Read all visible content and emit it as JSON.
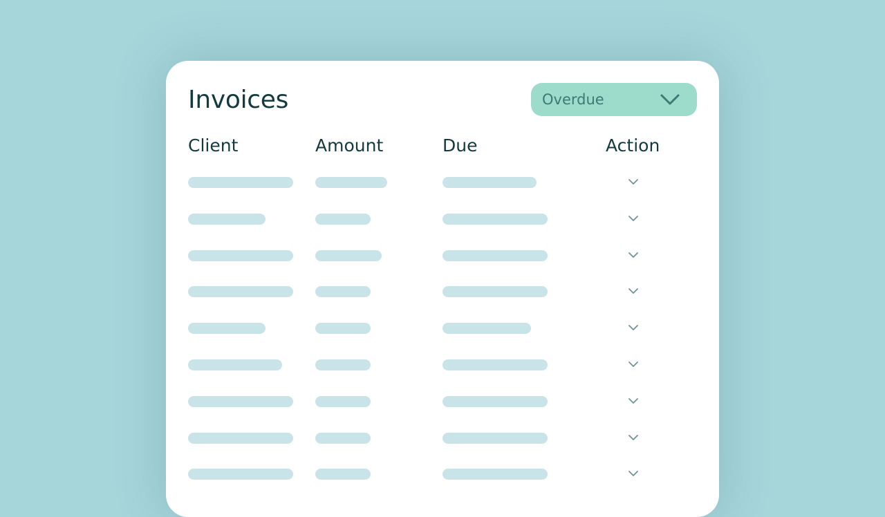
{
  "page": {
    "title": "Invoices"
  },
  "filter": {
    "selected": "Overdue",
    "icon": "chevron-down-icon"
  },
  "table": {
    "columns": [
      "Client",
      "Amount",
      "Due",
      "Action"
    ],
    "rows": [
      {
        "client": "",
        "amount": "",
        "due": "",
        "action_icon": "chevron-down-icon"
      },
      {
        "client": "",
        "amount": "",
        "due": "",
        "action_icon": "chevron-down-icon"
      },
      {
        "client": "",
        "amount": "",
        "due": "",
        "action_icon": "chevron-down-icon"
      },
      {
        "client": "",
        "amount": "",
        "due": "",
        "action_icon": "chevron-down-icon"
      },
      {
        "client": "",
        "amount": "",
        "due": "",
        "action_icon": "chevron-down-icon"
      },
      {
        "client": "",
        "amount": "",
        "due": "",
        "action_icon": "chevron-down-icon"
      },
      {
        "client": "",
        "amount": "",
        "due": "",
        "action_icon": "chevron-down-icon"
      },
      {
        "client": "",
        "amount": "",
        "due": "",
        "action_icon": "chevron-down-icon"
      },
      {
        "client": "",
        "amount": "",
        "due": "",
        "action_icon": "chevron-down-icon"
      }
    ]
  },
  "colors": {
    "background": "#a6d5da",
    "card": "#ffffff",
    "text": "#133a3f",
    "filter_bg": "#9ddbca",
    "filter_text": "#3c7a73",
    "placeholder_bar": "#c8e4e8",
    "chevron": "#6f9497"
  }
}
